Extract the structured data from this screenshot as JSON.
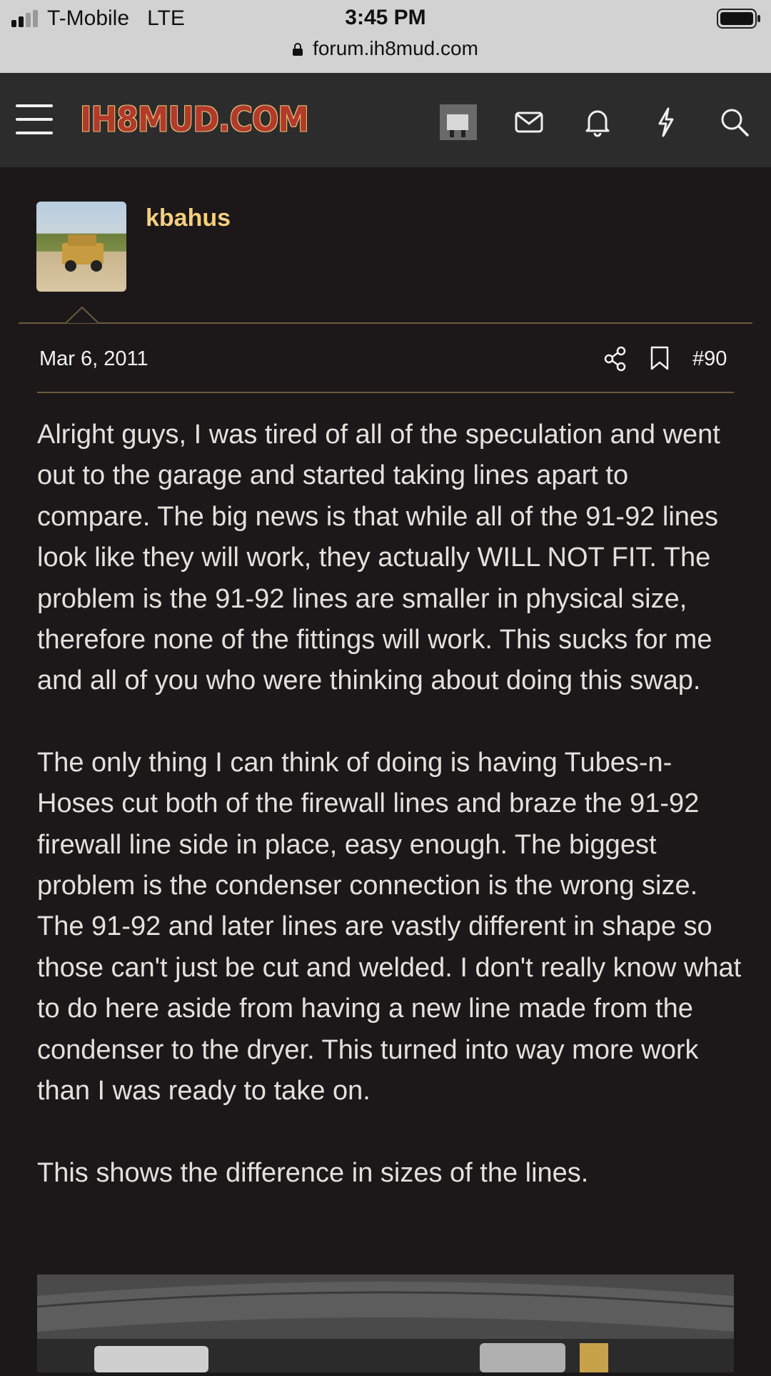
{
  "status_bar": {
    "carrier": "T-Mobile",
    "network": "LTE",
    "time": "3:45 PM",
    "url": "forum.ih8mud.com"
  },
  "nav": {
    "logo_text": "IH8MUD.COM",
    "icons": [
      "menu-icon",
      "avatar",
      "mail-icon",
      "bell-icon",
      "lightning-icon",
      "search-icon"
    ]
  },
  "post": {
    "username": "kbahus",
    "date": "Mar 6, 2011",
    "post_number": "#90",
    "paragraphs": [
      "Alright guys, I was tired of all of the speculation and went out to the garage and started taking lines apart to compare. The big news is that while all of the 91-92 lines look like they will work, they actually WILL NOT FIT. The problem is the 91-92 lines are smaller in physical size, therefore none of the fittings will work. This sucks for me and all of you who were thinking about doing this swap.",
      "The only thing I can think of doing is having Tubes-n-Hoses cut both of the firewall lines and braze the 91-92 firewall line side in place, easy enough. The biggest problem is the condenser connection is the wrong size. The 91-92 and later lines are vastly different in shape so those can't just be cut and welded. I don't really know what to do here aside from having a new line made from the condenser to the dryer. This turned into way more work than I was ready to take on.",
      "This shows the difference in sizes of the lines."
    ]
  },
  "colors": {
    "background": "#1c1819",
    "navbar": "#2d2c2d",
    "username": "#f5cf7c",
    "separator": "#6b5a3e"
  }
}
